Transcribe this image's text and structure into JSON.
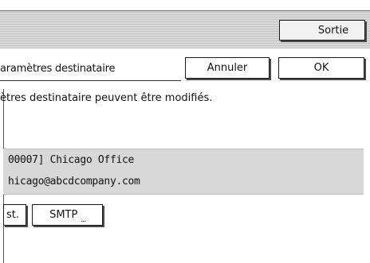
{
  "header": {
    "exit_label": "Sortie"
  },
  "dialog": {
    "title": "aramètres destinataire",
    "cancel_label": "Annuler",
    "ok_label": "OK",
    "info": "ètres destinataire peuvent être modifiés."
  },
  "destination": {
    "line1": "00007] Chicago Office",
    "line2": "hicago@abcdcompany.com"
  },
  "buttons": {
    "dest_label": "st.",
    "smtp_label": "SMTP",
    "smtp_suffix": "..."
  }
}
